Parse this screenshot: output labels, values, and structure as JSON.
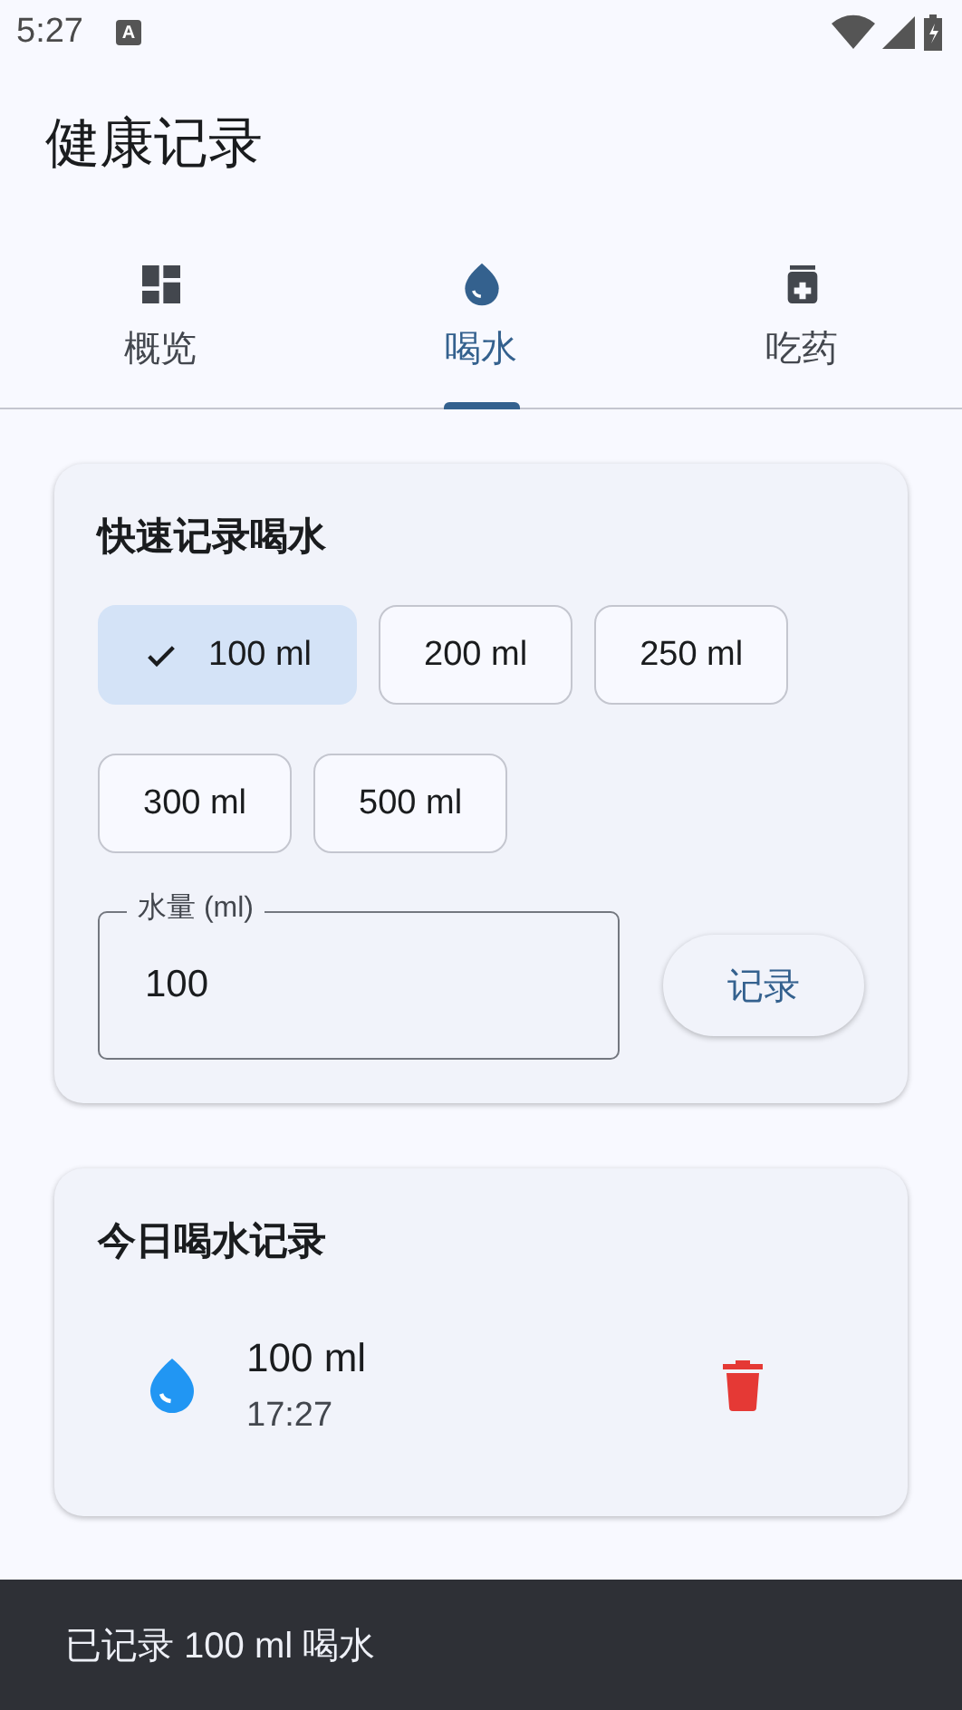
{
  "status_bar": {
    "time": "5:27",
    "badge": "A"
  },
  "app_bar": {
    "title": "健康记录"
  },
  "tabs": [
    {
      "label": "概览",
      "kind": "dashboard",
      "selected": false
    },
    {
      "label": "喝水",
      "kind": "drop",
      "selected": true
    },
    {
      "label": "吃药",
      "kind": "medicine",
      "selected": false
    }
  ],
  "quick_card": {
    "title": "快速记录喝水",
    "chips": [
      {
        "label": "100 ml",
        "selected": true
      },
      {
        "label": "200 ml",
        "selected": false
      },
      {
        "label": "250 ml",
        "selected": false
      },
      {
        "label": "300 ml",
        "selected": false
      },
      {
        "label": "500 ml",
        "selected": false
      }
    ],
    "field": {
      "label": "水量 (ml)",
      "value": "100"
    },
    "button": "记录"
  },
  "log_card": {
    "title": "今日喝水记录",
    "entries": [
      {
        "amount": "100 ml",
        "time": "17:27"
      }
    ]
  },
  "snackbar": {
    "message": "已记录 100 ml 喝水"
  }
}
